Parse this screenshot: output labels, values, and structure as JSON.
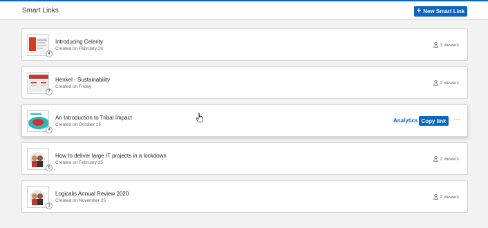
{
  "header": {
    "title": "Smart Links",
    "new_button_label": "New Smart Link",
    "new_button_icon": "plus-icon"
  },
  "accent_color": "#0a66c2",
  "items": [
    {
      "title": "Introducing Celerity",
      "created": "Created on February 26",
      "badge": "4",
      "viewers": "3 viewers",
      "thumb": "red-document"
    },
    {
      "title": "Henkel - Sustainability",
      "created": "Created on Friday",
      "badge": "7",
      "viewers": "2 viewers",
      "thumb": "red-pages"
    },
    {
      "title": "An Introduction to Tribal Impact",
      "created": "Created on October 15",
      "badge": "4",
      "viewers": "",
      "thumb": "teal-red-graphic",
      "analytics_label": "Analytics",
      "copy_label": "Copy link",
      "more_label": "···"
    },
    {
      "title": "How to deliver large IT projects in a lockdown",
      "created": "Created on February 15",
      "badge": "6",
      "viewers": "2 viewers",
      "thumb": "people-photo"
    },
    {
      "title": "Logicalis Annual Review 2020",
      "created": "Created on November 25",
      "badge": "3",
      "viewers": "2 viewers",
      "thumb": "people-photo"
    }
  ]
}
